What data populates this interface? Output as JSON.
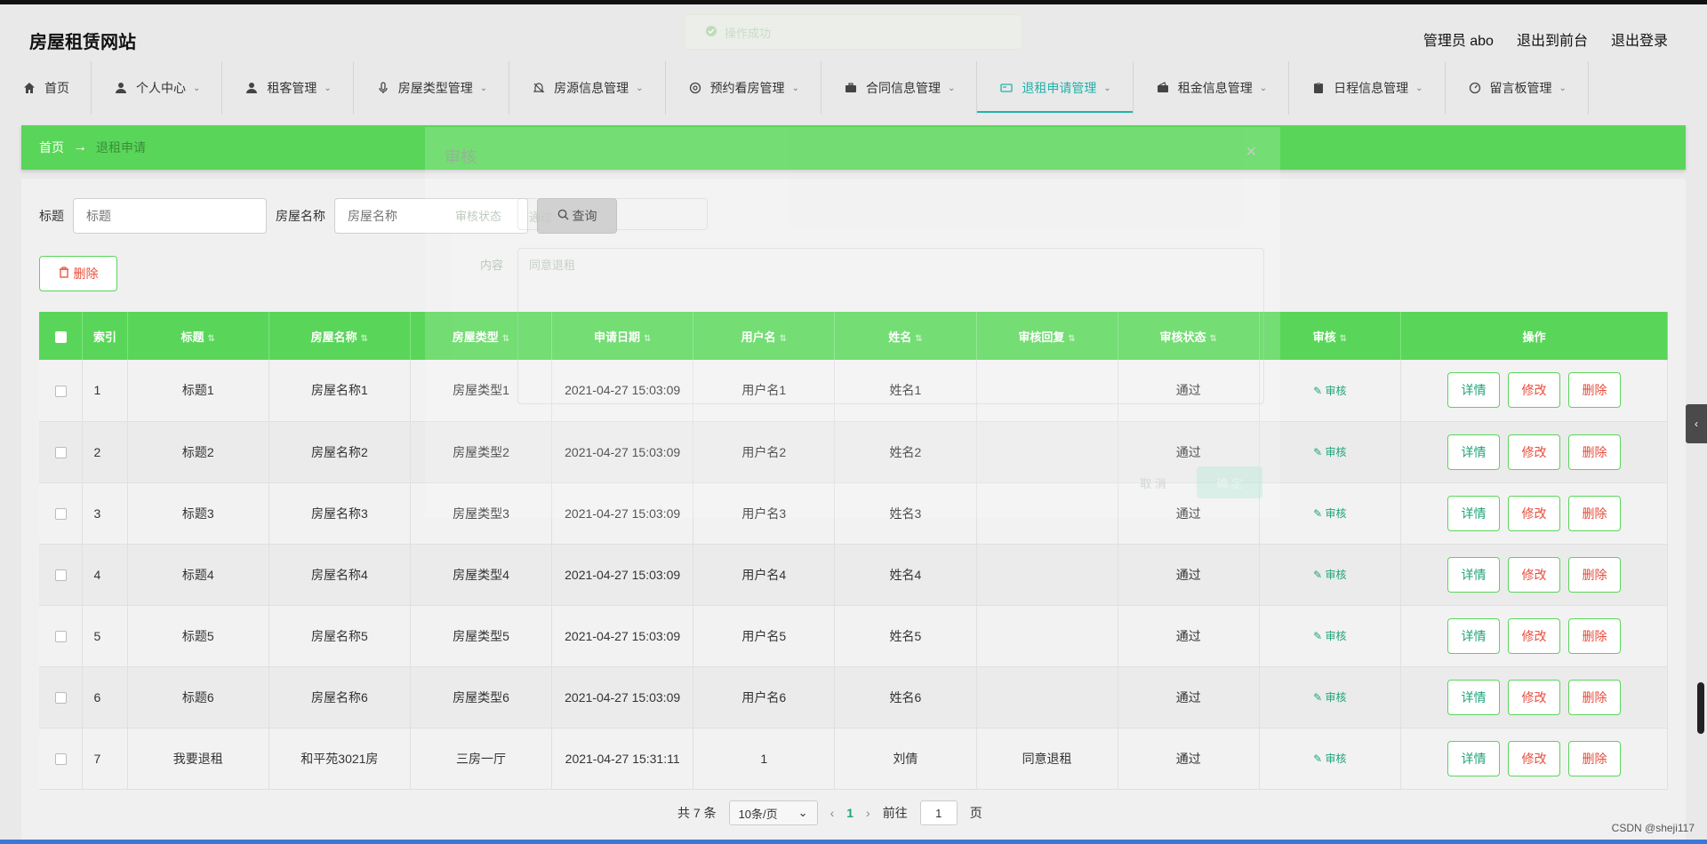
{
  "header": {
    "site_title": "房屋租赁网站",
    "admin": "管理员 abo",
    "to_front": "退出到前台",
    "logout": "退出登录"
  },
  "toast": {
    "text": "操作成功"
  },
  "nav": {
    "items": [
      {
        "label": "首页",
        "icon": "home-icon"
      },
      {
        "label": "个人中心",
        "icon": "user-icon"
      },
      {
        "label": "租客管理",
        "icon": "user-icon"
      },
      {
        "label": "房屋类型管理",
        "icon": "mic-icon"
      },
      {
        "label": "房源信息管理",
        "icon": "bell-off-icon"
      },
      {
        "label": "预约看房管理",
        "icon": "aperture-icon"
      },
      {
        "label": "合同信息管理",
        "icon": "briefcase-icon"
      },
      {
        "label": "退租申请管理",
        "icon": "card-icon"
      },
      {
        "label": "租金信息管理",
        "icon": "wallet-icon"
      },
      {
        "label": "日程信息管理",
        "icon": "clipboard-icon"
      },
      {
        "label": "留言板管理",
        "icon": "gauge-icon"
      }
    ]
  },
  "breadcrumb": {
    "home": "首页",
    "arrow": "→",
    "current": "退租申请"
  },
  "search": {
    "title_label": "标题",
    "title_placeholder": "标题",
    "house_label": "房屋名称",
    "house_placeholder": "房屋名称",
    "query_button": "查询"
  },
  "delete_button": "删除",
  "table": {
    "headers": [
      "索引",
      "标题",
      "房屋名称",
      "房屋类型",
      "申请日期",
      "用户名",
      "姓名",
      "审核回复",
      "审核状态",
      "审核",
      "操作"
    ],
    "rows": [
      {
        "idx": "1",
        "title": "标题1",
        "house": "房屋名称1",
        "type": "房屋类型1",
        "date": "2021-04-27 15:03:09",
        "username": "用户名1",
        "name": "姓名1",
        "reply": "",
        "status": "通过"
      },
      {
        "idx": "2",
        "title": "标题2",
        "house": "房屋名称2",
        "type": "房屋类型2",
        "date": "2021-04-27 15:03:09",
        "username": "用户名2",
        "name": "姓名2",
        "reply": "",
        "status": "通过"
      },
      {
        "idx": "3",
        "title": "标题3",
        "house": "房屋名称3",
        "type": "房屋类型3",
        "date": "2021-04-27 15:03:09",
        "username": "用户名3",
        "name": "姓名3",
        "reply": "",
        "status": "通过"
      },
      {
        "idx": "4",
        "title": "标题4",
        "house": "房屋名称4",
        "type": "房屋类型4",
        "date": "2021-04-27 15:03:09",
        "username": "用户名4",
        "name": "姓名4",
        "reply": "",
        "status": "通过"
      },
      {
        "idx": "5",
        "title": "标题5",
        "house": "房屋名称5",
        "type": "房屋类型5",
        "date": "2021-04-27 15:03:09",
        "username": "用户名5",
        "name": "姓名5",
        "reply": "",
        "status": "通过"
      },
      {
        "idx": "6",
        "title": "标题6",
        "house": "房屋名称6",
        "type": "房屋类型6",
        "date": "2021-04-27 15:03:09",
        "username": "用户名6",
        "name": "姓名6",
        "reply": "",
        "status": "通过"
      },
      {
        "idx": "7",
        "title": "我要退租",
        "house": "和平苑3021房",
        "type": "三房一厅",
        "date": "2021-04-27 15:31:11",
        "username": "1",
        "name": "刘倩",
        "reply": "同意退租",
        "status": "通过"
      }
    ],
    "audit_label": "审核",
    "op_detail": "详情",
    "op_edit": "修改",
    "op_delete": "删除"
  },
  "pager": {
    "total": "共 7 条",
    "page_size": "10条/页",
    "current": "1",
    "goto_prefix": "前往",
    "goto_value": "1",
    "goto_suffix": "页"
  },
  "dialog": {
    "title": "审核",
    "status_label": "审核状态",
    "status_value": "通过",
    "content_label": "内容",
    "content_value": "同意退租",
    "cancel": "取 消",
    "ok": "确 定"
  },
  "watermark": "CSDN @sheji117",
  "colors": {
    "accent": "#59d659",
    "link": "#20a37a",
    "danger": "#e74c3c"
  }
}
